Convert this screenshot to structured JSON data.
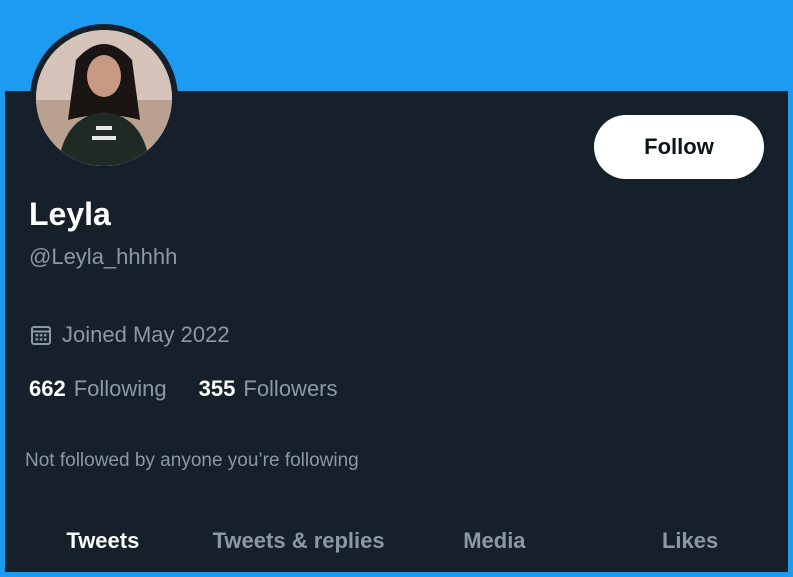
{
  "profile": {
    "name": "Leyla",
    "handle": "@Leyla_hhhhh",
    "joined": "Joined May 2022",
    "follow_label": "Follow",
    "not_followed_note": "Not followed by anyone you’re following"
  },
  "stats": {
    "following_count": "662",
    "following_label": "Following",
    "followers_count": "355",
    "followers_label": "Followers"
  },
  "tabs": [
    {
      "label": "Tweets",
      "active": true
    },
    {
      "label": "Tweets & replies",
      "active": false
    },
    {
      "label": "Media",
      "active": false
    },
    {
      "label": "Likes",
      "active": false
    }
  ],
  "colors": {
    "banner": "#1d9bf0",
    "background": "#16202b",
    "secondary_text": "#8b98a5",
    "primary_text": "#ffffff"
  },
  "icons": {
    "joined": "calendar-icon"
  }
}
